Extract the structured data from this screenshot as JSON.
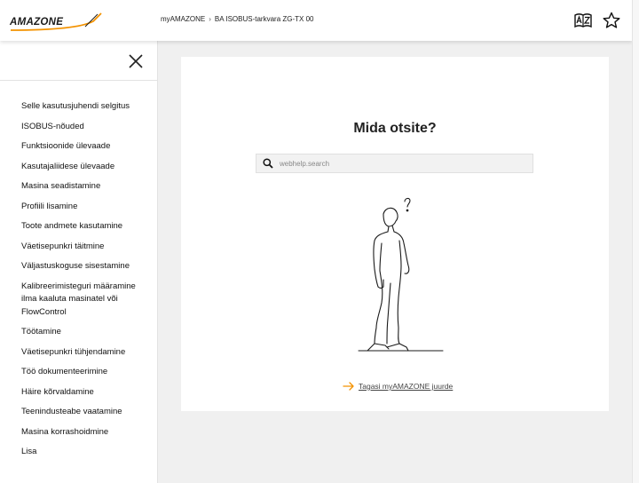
{
  "header": {
    "logo_text": "AMAZONE",
    "breadcrumb": [
      "myAMAZONE",
      "BA ISOBUS-tarkvara ZG-TX 00"
    ],
    "breadcrumb_separator": "›",
    "icons": [
      "language-dictionary-icon",
      "star-icon"
    ]
  },
  "sidebar": {
    "close_icon": "close-icon",
    "items": [
      "Selle kasutusjuhendi selgitus",
      "ISOBUS-nõuded",
      "Funktsioonide ülevaade",
      "Kasutajaliidese ülevaade",
      "Masina seadistamine",
      "Profiili lisamine",
      "Toote andmete kasutamine",
      "Väetisepunkri täitmine",
      "Väljastuskoguse sisestamine",
      "Kalibreerimisteguri määramine ilma kaaluta masinatel või FlowControl",
      "Töötamine",
      "Väetisepunkri tühjendamine",
      "Töö dokumenteerimine",
      "Häire kõrvaldamine",
      "Teenindusteabe vaatamine",
      "Masina korrashoidmine",
      "Lisa"
    ]
  },
  "main": {
    "title": "Mida otsite?",
    "search": {
      "placeholder": "webhelp.search",
      "value": ""
    },
    "back_link": "Tagasi myAMAZONE juurde"
  },
  "colors": {
    "accent": "#f39200",
    "text": "#222222",
    "panel": "#f0f0f0"
  }
}
